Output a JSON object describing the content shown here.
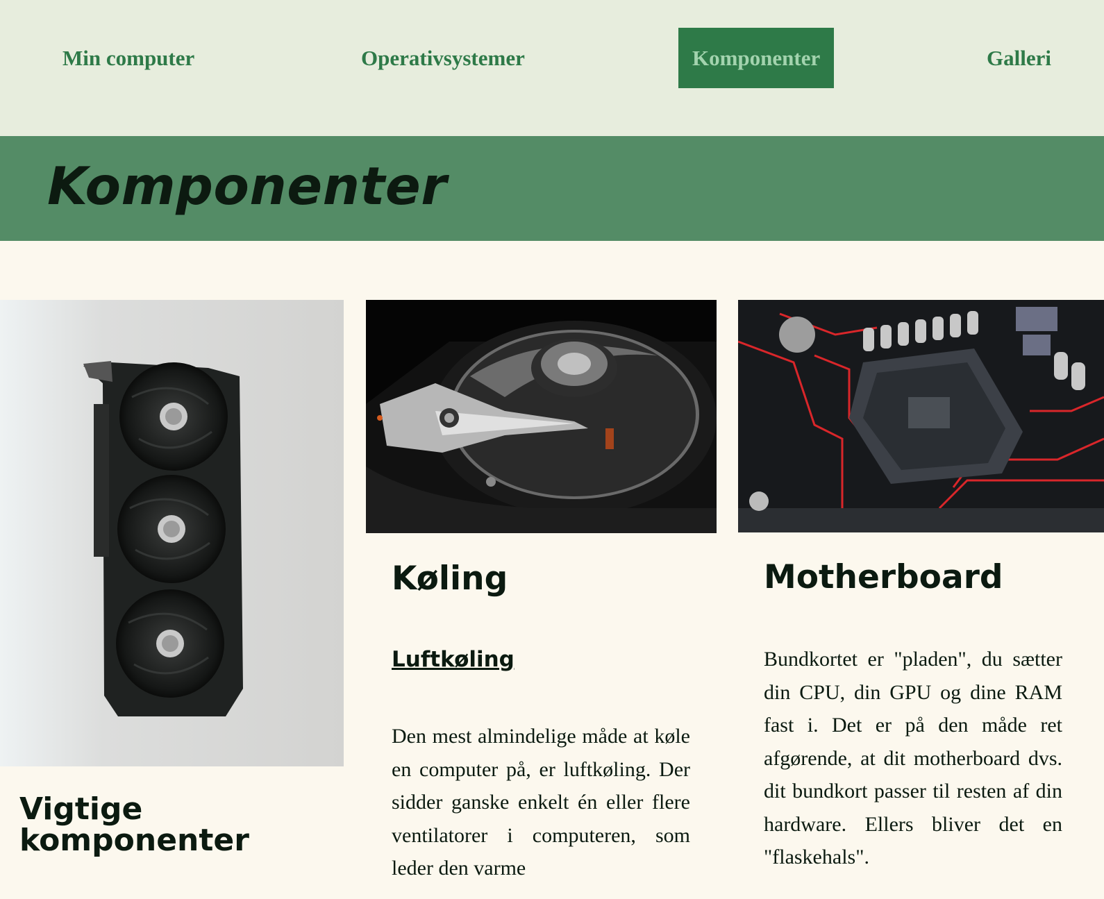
{
  "nav": {
    "items": [
      {
        "label": "Min computer"
      },
      {
        "label": "Operativsystemer"
      },
      {
        "label": "Komponenter",
        "active": true
      },
      {
        "label": "Galleri"
      }
    ]
  },
  "banner": {
    "title": "Komponenter"
  },
  "cards": {
    "gpu": {
      "heading": "Vigtige komponenter"
    },
    "cooling": {
      "heading": "Køling",
      "subheading": "Luftkøling",
      "text": "Den mest almindelige måde at køle en computer på, er luftkøling. Der sidder ganske enkelt én eller flere ventilatorer i computeren, som leder den varme"
    },
    "motherboard": {
      "heading": "Motherboard",
      "text": "Bundkortet er \"pladen\", du sætter din CPU, din GPU og dine RAM fast i. Det er på den måde ret afgørende, at dit motherboard dvs. dit bundkort passer til resten af din hardware. Ellers bliver det en \"flaskehals\"."
    }
  },
  "colors": {
    "nav_bg": "#e7eddd",
    "nav_text": "#2e7a48",
    "banner_bg": "#548c66",
    "page_bg": "#fcf8ee"
  }
}
